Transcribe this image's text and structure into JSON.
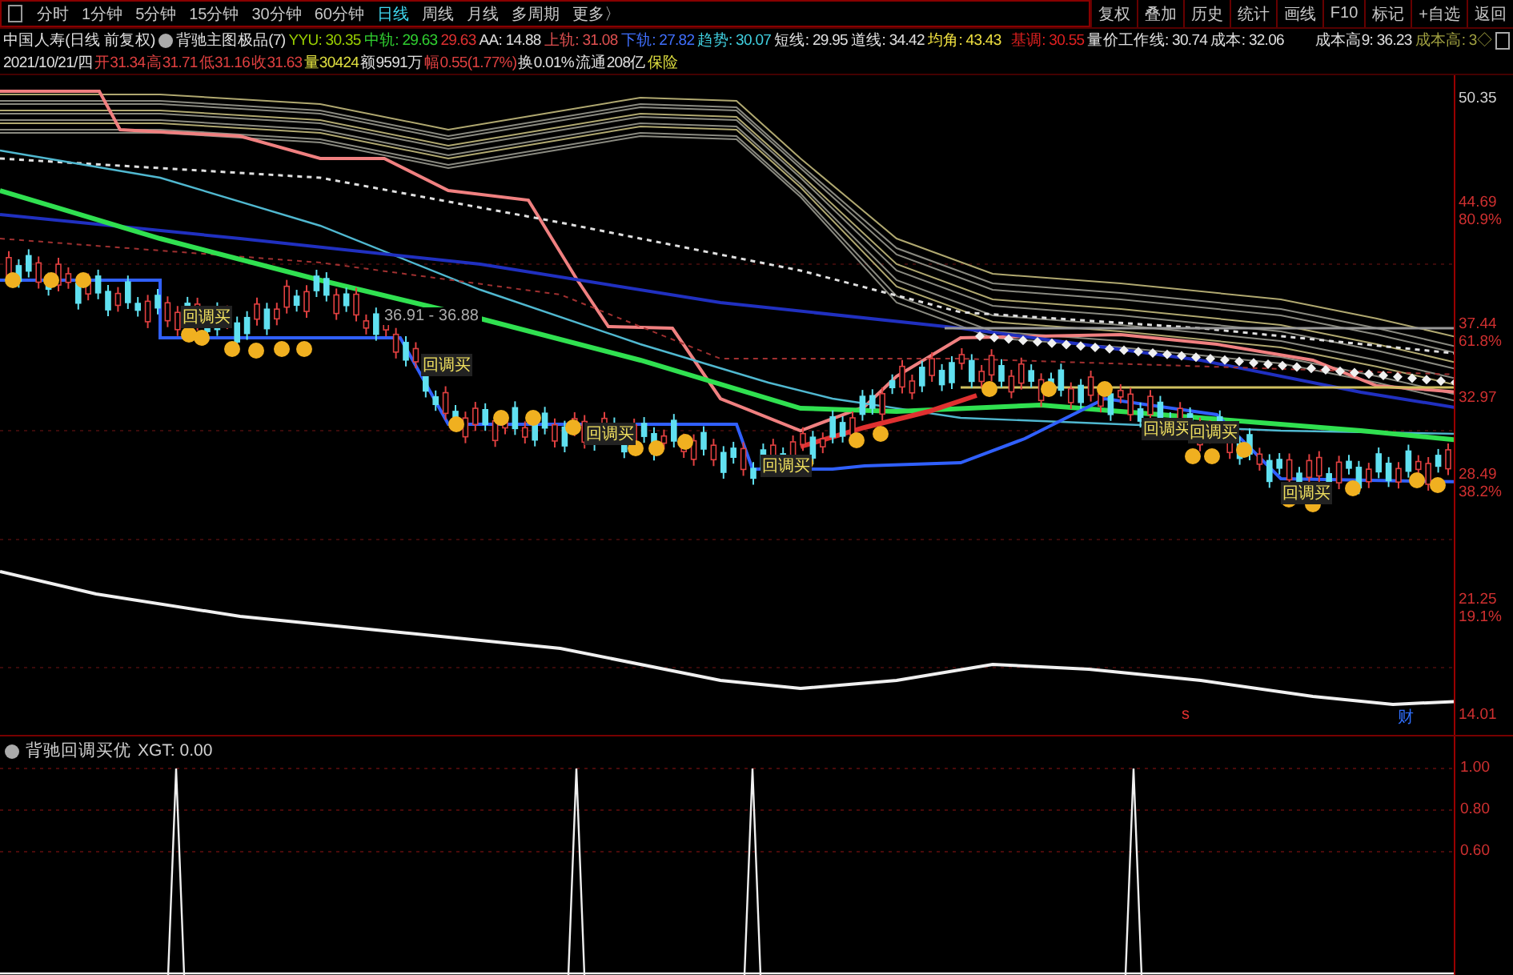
{
  "toolbar": {
    "periods": [
      {
        "label": "分时",
        "selected": false
      },
      {
        "label": "1分钟",
        "selected": false
      },
      {
        "label": "5分钟",
        "selected": false
      },
      {
        "label": "15分钟",
        "selected": false
      },
      {
        "label": "30分钟",
        "selected": false
      },
      {
        "label": "60分钟",
        "selected": false
      },
      {
        "label": "日线",
        "selected": true
      },
      {
        "label": "周线",
        "selected": false
      },
      {
        "label": "月线",
        "selected": false
      },
      {
        "label": "多周期",
        "selected": false
      },
      {
        "label": "更多〉",
        "selected": false
      }
    ],
    "actions": [
      "复权",
      "叠加",
      "历史",
      "统计",
      "画线",
      "F10",
      "标记",
      "+自选",
      "返回"
    ]
  },
  "stock_title": "中国人寿(日线 前复权)",
  "indicator_name": "背驰主图极品(7)",
  "indicator_values": [
    {
      "text": "YYU: 30.35",
      "color": "#9ad000"
    },
    {
      "text": "中轨: 29.63",
      "color": "#30d030"
    },
    {
      "text": "29.63",
      "color": "#e03030"
    },
    {
      "text": "AA: 14.88",
      "color": "#e0e0e0"
    },
    {
      "text": "上轨: 31.08",
      "color": "#e05050"
    },
    {
      "text": "下轨: 27.82",
      "color": "#4070ff"
    },
    {
      "text": "趋势: 30.07",
      "color": "#40d0e0"
    },
    {
      "text": "短线: 29.95",
      "color": "#e0e0e0"
    },
    {
      "text": "道线: 34.42",
      "color": "#e0e0e0"
    },
    {
      "text": "均角: 43.43",
      "color": "#f0e040"
    },
    {
      "text": "基调: 30.55",
      "color": "#e02020"
    },
    {
      "text": "量价工作线: 30.74",
      "color": "#e0e0e0"
    },
    {
      "text": "成本: 32.06",
      "color": "#e0e0e0"
    },
    {
      "text": "成本高9: 36.23",
      "color": "#e0e0e0"
    },
    {
      "text": "成本高: 3◇",
      "color": "#a0a040"
    }
  ],
  "quote": [
    {
      "text": "2021/10/21/四",
      "color": "#e0e0e0"
    },
    {
      "text": "开31.34",
      "color": "#e04040"
    },
    {
      "text": "高31.71",
      "color": "#e04040"
    },
    {
      "text": "低31.16",
      "color": "#e04040"
    },
    {
      "text": "收31.63",
      "color": "#e04040"
    },
    {
      "text": "量30424",
      "color": "#e0e040"
    },
    {
      "text": "额9591万",
      "color": "#e0e0e0"
    },
    {
      "text": "幅0.55(1.77%)",
      "color": "#e04040"
    },
    {
      "text": "换0.01%",
      "color": "#e0e0e0"
    },
    {
      "text": "流通208亿",
      "color": "#e0e0e0"
    },
    {
      "text": "保险",
      "color": "#e0e040"
    }
  ],
  "price_axis": [
    {
      "price": "50.35"
    },
    {
      "price": "44.69",
      "pct": "80.9%"
    },
    {
      "price": "37.44",
      "pct": "61.8%"
    },
    {
      "price": "32.97"
    },
    {
      "price": "28.49",
      "pct": "38.2%"
    },
    {
      "price": "21.25",
      "pct": "19.1%"
    },
    {
      "price": "14.01"
    }
  ],
  "chart_marks": [
    {
      "text": "回调买",
      "kind": "signal"
    },
    {
      "text": "36.91 - 36.88",
      "kind": "range"
    },
    {
      "text": "回调买",
      "kind": "signal"
    },
    {
      "text": "回调买",
      "kind": "signal"
    },
    {
      "text": "回调买",
      "kind": "signal"
    },
    {
      "text": "回调买",
      "kind": "signal"
    },
    {
      "text": "回调买",
      "kind": "signal"
    },
    {
      "text": "回调买",
      "kind": "signal"
    },
    {
      "text": "s",
      "kind": "event"
    },
    {
      "text": "财",
      "kind": "note"
    }
  ],
  "sub_panel": {
    "title": "背驰回调买优",
    "reading": "XGT: 0.00",
    "axis": [
      "1.00",
      "0.80",
      "0.60"
    ]
  }
}
